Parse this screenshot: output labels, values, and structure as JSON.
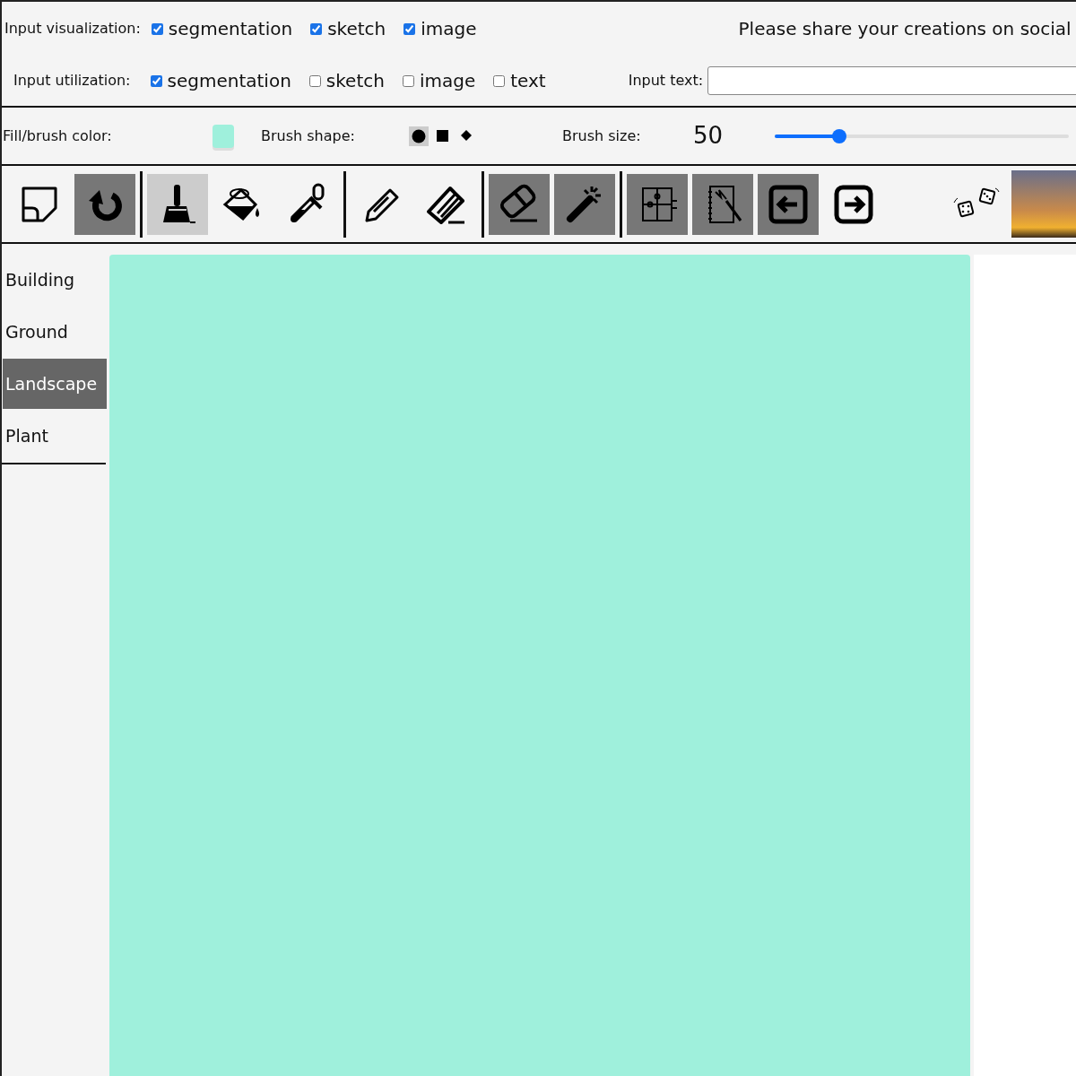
{
  "visualization": {
    "label": "Input visualization:",
    "options": [
      {
        "label": "segmentation",
        "checked": true
      },
      {
        "label": "sketch",
        "checked": true
      },
      {
        "label": "image",
        "checked": true
      }
    ]
  },
  "notice": "Please share your creations on social",
  "utilization": {
    "label": "Input utilization:",
    "options": [
      {
        "label": "segmentation",
        "checked": true
      },
      {
        "label": "sketch",
        "checked": false
      },
      {
        "label": "image",
        "checked": false
      },
      {
        "label": "text",
        "checked": false
      }
    ]
  },
  "input_text": {
    "label": "Input text:"
  },
  "brush": {
    "color_label": "Fill/brush color:",
    "color": "#9ff0dc",
    "shape_label": "Brush shape:",
    "shapes": [
      {
        "kind": "circle",
        "selected": true
      },
      {
        "kind": "square",
        "selected": false
      },
      {
        "kind": "diamond",
        "selected": false
      }
    ],
    "size_label": "Brush size:",
    "size": "50",
    "level": 0.22
  },
  "toolbar": [
    [
      {
        "kind": "page",
        "on": false,
        "selected": false
      },
      {
        "kind": "redo",
        "on": true,
        "selected": false
      }
    ],
    [
      {
        "kind": "brush",
        "on": false,
        "selected": true
      },
      {
        "kind": "bucket",
        "on": false,
        "selected": false
      },
      {
        "kind": "dropper",
        "on": false,
        "selected": false
      }
    ],
    [
      {
        "kind": "pencil",
        "on": false,
        "selected": false
      },
      {
        "kind": "line-eraser",
        "on": false,
        "selected": false
      }
    ],
    [
      {
        "kind": "eraser",
        "on": true,
        "selected": false
      },
      {
        "kind": "wand",
        "on": true,
        "selected": false
      }
    ],
    [
      {
        "kind": "puzzle",
        "on": true,
        "selected": false
      },
      {
        "kind": "notebook",
        "on": true,
        "selected": false
      },
      {
        "kind": "arrow-left",
        "on": true,
        "selected": false
      },
      {
        "kind": "arrow-right",
        "on": false,
        "selected": false
      }
    ]
  ],
  "categories": [
    {
      "label": "Building",
      "selected": false
    },
    {
      "label": "Ground",
      "selected": false
    },
    {
      "label": "Landscape",
      "selected": true
    },
    {
      "label": "Plant",
      "selected": false
    }
  ],
  "canvas": {
    "color": "#9ff0dc"
  }
}
